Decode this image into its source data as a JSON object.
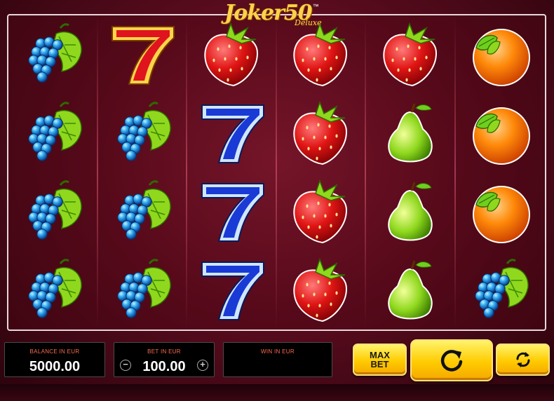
{
  "game": {
    "logo_text": "Joker",
    "logo_number": "50",
    "logo_sub": "Deluxe",
    "logo_tm": "™"
  },
  "reels": {
    "grid": [
      [
        "grapes",
        "seven-red",
        "strawberry",
        "strawberry",
        "strawberry",
        "orange"
      ],
      [
        "grapes",
        "grapes",
        "seven-blue",
        "strawberry",
        "pear",
        "orange"
      ],
      [
        "grapes",
        "grapes",
        "seven-blue",
        "strawberry",
        "pear",
        "orange"
      ],
      [
        "grapes",
        "grapes",
        "seven-blue",
        "strawberry",
        "pear",
        "grapes"
      ]
    ]
  },
  "balance": {
    "label": "BALANCE IN EUR",
    "value": "5000.00"
  },
  "bet": {
    "label": "BET IN EUR",
    "value": "100.00",
    "minus": "−",
    "plus": "+"
  },
  "win": {
    "label": "WIN IN EUR",
    "value": ""
  },
  "buttons": {
    "max_bet_line1": "MAX",
    "max_bet_line2": "BET",
    "spin_icon": "spin-arrow-icon",
    "autoplay_icon": "autoplay-icon"
  },
  "colors": {
    "background": "#5a0c1e",
    "button_yellow": "#ffcb00",
    "label_orange": "#ff6a4a"
  }
}
